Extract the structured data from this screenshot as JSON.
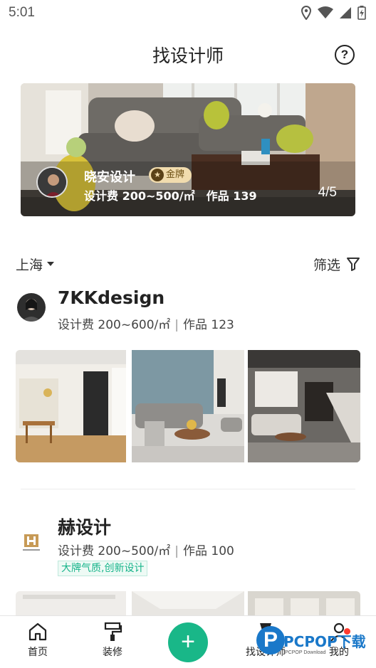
{
  "status": {
    "time": "5:01",
    "icons": [
      "location-icon",
      "wifi-icon",
      "signal-icon",
      "battery-icon"
    ]
  },
  "header": {
    "title": "找设计师",
    "help": "?"
  },
  "banner": {
    "name": "晓安设计",
    "badge": "金牌",
    "fee": "设计费 200~500/㎡",
    "works": "作品 139",
    "page": "4/5"
  },
  "filter": {
    "city": "上海",
    "filter_label": "筛选"
  },
  "designers": [
    {
      "name": "7KKdesign",
      "fee": "设计费 200~600/㎡",
      "sep": "|",
      "works": "作品 123"
    },
    {
      "name": "赫设计",
      "fee": "设计费 200~500/㎡",
      "sep": "|",
      "works": "作品 100",
      "tag": "大牌气质,创新设计"
    }
  ],
  "tabs": [
    {
      "label": "首页",
      "icon": "home-icon"
    },
    {
      "label": "装修",
      "icon": "paint-roller-icon"
    },
    {
      "label": "+",
      "icon": "plus-icon"
    },
    {
      "label": "找设计师",
      "icon": "designer-icon"
    },
    {
      "label": "我的",
      "icon": "user-icon"
    }
  ],
  "watermark": {
    "text": "PCPOP下载",
    "sub": "PCPOP Download",
    "logo": "P"
  },
  "colors": {
    "accent": "#19b788",
    "badge": "#f1dcae",
    "tag_text": "#16b48a"
  }
}
